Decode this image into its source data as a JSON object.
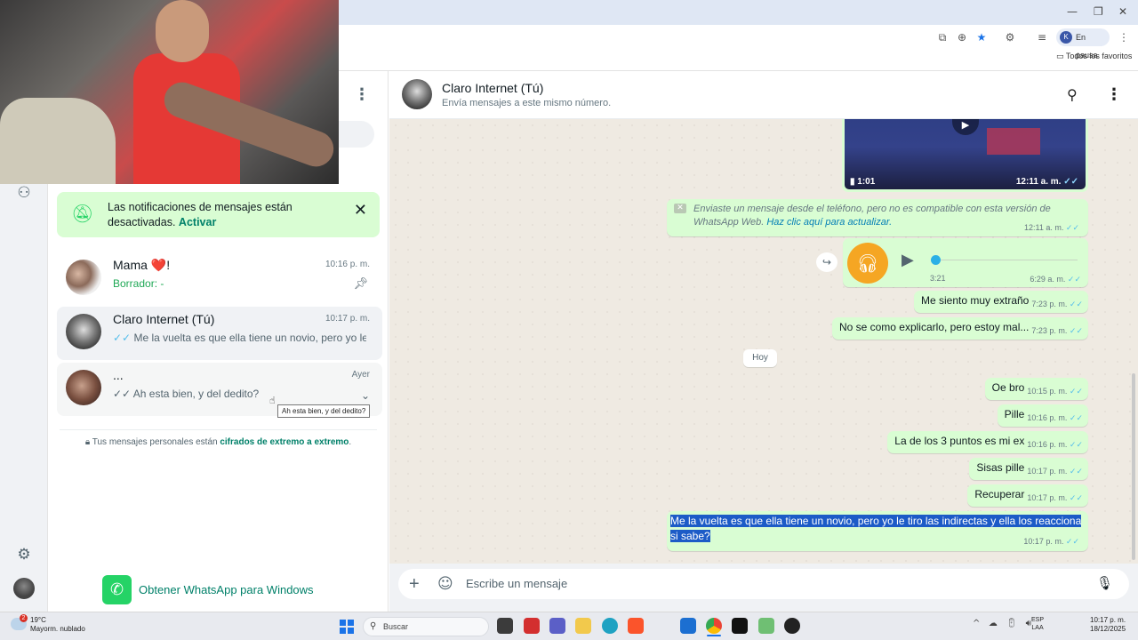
{
  "browser": {
    "window_controls": [
      "—",
      "❐",
      "✕"
    ],
    "profile_initial": "K",
    "profile_status": "En pausa",
    "favorites_label": "Todos los favoritos"
  },
  "notification_banner": {
    "text": "Las notificaciones de mensajes están desactivadas.",
    "action": "Activar"
  },
  "chats": [
    {
      "name": "Mama ❤️!",
      "time": "10:16 p. m.",
      "preview_prefix": "Borrador:",
      "preview": " -",
      "pinned": true
    },
    {
      "name": "Claro Internet (Tú)",
      "time": "10:17 p. m.",
      "ticks": "✓✓",
      "preview": "Me la vuelta es que ella tiene un novio, pero yo le t..."
    },
    {
      "name": "...",
      "time": "Ayer",
      "ticks": "✓✓",
      "preview": "Ah esta bien, y del dedito?"
    }
  ],
  "tooltip": "Ah esta bien, y del dedito?",
  "e2e": {
    "prefix": "Tus mensajes personales están ",
    "link": "cifrados de extremo a extremo",
    "suffix": "."
  },
  "windows_cta": "Obtener WhatsApp para Windows",
  "conversation": {
    "name": "Claro Internet (Tú)",
    "subtitle": "Envía mensajes a este mismo número.",
    "video": {
      "duration": "1:01",
      "time": "12:11 a. m."
    },
    "unsupported": {
      "text": "Enviaste un mensaje desde el teléfono, pero no es compatible con esta versión de WhatsApp Web.",
      "link": "Haz clic aquí para actualizar.",
      "time": "12:11 a. m."
    },
    "audio": {
      "duration": "3:21",
      "time": "6:29 a. m.",
      "progress": 0.0
    },
    "earlier_messages": [
      {
        "text": "Me siento muy extraño",
        "time": "7:23 p. m."
      },
      {
        "text": "No se como explicarlo, pero estoy mal...",
        "time": "7:23 p. m."
      }
    ],
    "date_chip": "Hoy",
    "today_messages": [
      {
        "text": "Oe bro",
        "time": "10:15 p. m."
      },
      {
        "text": "Pille",
        "time": "10:16 p. m."
      },
      {
        "text": "La de los 3 puntos es mi ex",
        "time": "10:16 p. m."
      },
      {
        "text": "Sisas pille",
        "time": "10:17 p. m."
      },
      {
        "text": "Recuperar",
        "time": "10:17 p. m."
      }
    ],
    "last_message": {
      "text": "Me la vuelta es que ella tiene un novio, pero yo le tiro las indirectas y ella los reacciona si sabe?",
      "time": "10:17 p. m."
    },
    "ticks": "✓✓",
    "composer_placeholder": "Escribe un mensaje"
  },
  "taskbar": {
    "weather_badge": "2",
    "temperature": "19°C",
    "weather_desc": "Mayorm. nublado",
    "search_label": "Buscar",
    "lang_top": "ESP",
    "lang_bottom": "LAA",
    "time": "10:17 p. m.",
    "date": "18/12/2025"
  },
  "colors": {
    "accent": "#008069",
    "bubble": "#d9fdd3",
    "read_ticks": "#53bdeb",
    "selection": "#1c5bc7"
  }
}
